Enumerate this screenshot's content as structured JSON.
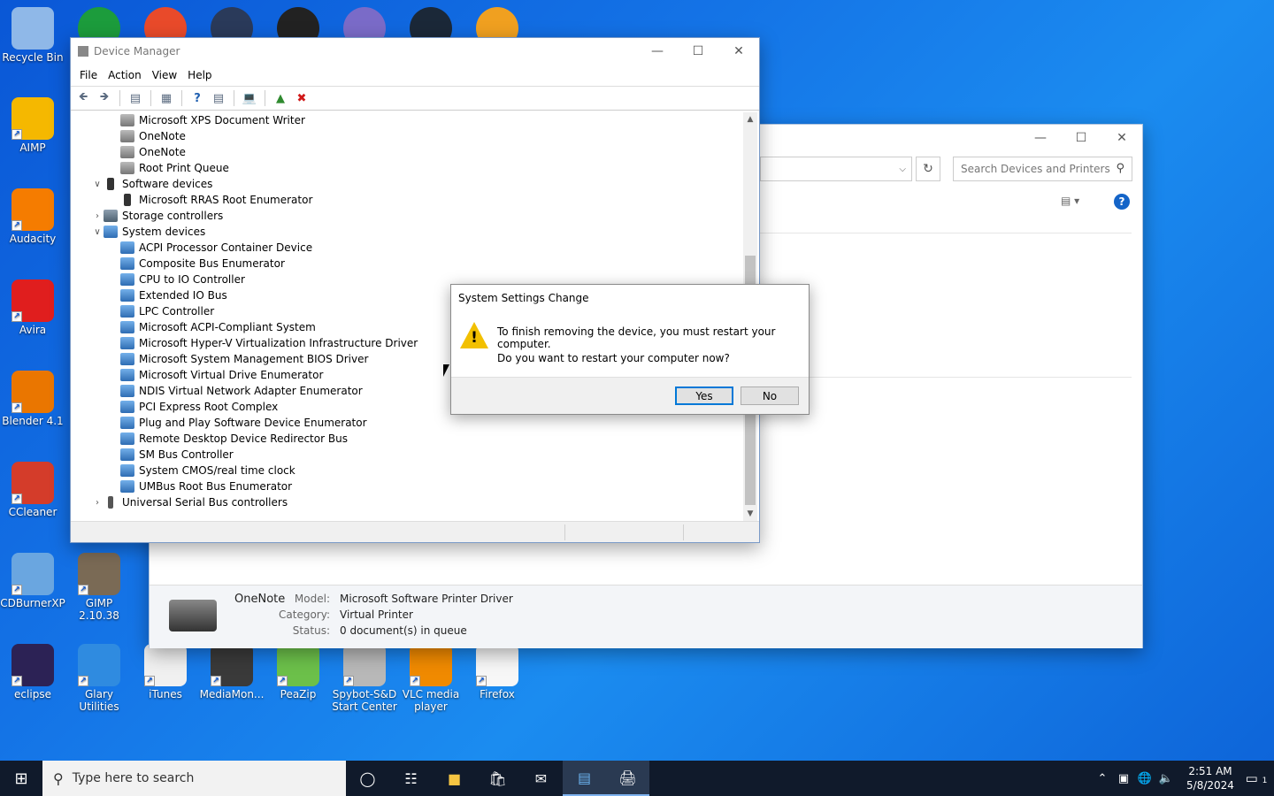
{
  "desktop": {
    "icons": [
      {
        "label": "Recycle Bin",
        "icon": "recycle-bin-icon",
        "color": "#8fb8e8"
      },
      {
        "label": "AIMP",
        "icon": "aimp-icon",
        "color": "#f5b800"
      },
      {
        "label": "Audacity",
        "icon": "audacity-icon",
        "color": "#f57c00"
      },
      {
        "label": "Avira",
        "icon": "avira-icon",
        "color": "#e01e1e"
      },
      {
        "label": "Blender 4.1",
        "icon": "blender-icon",
        "color": "#ea7600"
      },
      {
        "label": "CCleaner",
        "icon": "ccleaner-icon",
        "color": "#d43c2a"
      },
      {
        "label": "CDBurnerXP",
        "icon": "cdburnerxp-icon",
        "color": "#6aa6e0"
      },
      {
        "label": "GIMP 2.10.38",
        "icon": "gimp-icon",
        "color": "#7a6a55"
      },
      {
        "label": "eclipse",
        "icon": "eclipse-icon",
        "color": "#2c2255"
      },
      {
        "label": "Glary Utilities",
        "icon": "glary-utilities-icon",
        "color": "#2f8be0"
      },
      {
        "label": "iTunes",
        "icon": "itunes-icon",
        "color": "#f0f0f0"
      },
      {
        "label": "MediaMon...",
        "icon": "mediamonkey-icon",
        "color": "#3a3a3a"
      },
      {
        "label": "PeaZip",
        "icon": "peazip-icon",
        "color": "#6cc04a"
      },
      {
        "label": "Spybot-S&D Start Center",
        "icon": "spybot-icon",
        "color": "#b8b8b8"
      },
      {
        "label": "VLC media player",
        "icon": "vlc-icon",
        "color": "#f08a00"
      },
      {
        "label": "Firefox",
        "icon": "firefox-icon",
        "color": "#f7f7f7"
      }
    ]
  },
  "device_manager": {
    "title": "Device Manager",
    "menu": [
      "File",
      "Action",
      "View",
      "Help"
    ],
    "tree": [
      {
        "label": "Microsoft XPS Document Writer",
        "level": 2,
        "icon": "printer-icon"
      },
      {
        "label": "OneNote",
        "level": 2,
        "icon": "printer-icon"
      },
      {
        "label": "OneNote",
        "level": 2,
        "icon": "printer-icon"
      },
      {
        "label": "Root Print Queue",
        "level": 2,
        "icon": "printer-icon"
      },
      {
        "label": "Software devices",
        "level": 1,
        "icon": "software-device-icon",
        "expander": "expanded"
      },
      {
        "label": "Microsoft RRAS Root Enumerator",
        "level": 2,
        "icon": "software-device-icon"
      },
      {
        "label": "Storage controllers",
        "level": 1,
        "icon": "storage-controller-icon",
        "expander": "collapsed"
      },
      {
        "label": "System devices",
        "level": 1,
        "icon": "system-device-icon",
        "expander": "expanded"
      },
      {
        "label": "ACPI Processor Container Device",
        "level": 2,
        "icon": "system-device-icon"
      },
      {
        "label": "Composite Bus Enumerator",
        "level": 2,
        "icon": "system-device-icon"
      },
      {
        "label": "CPU to IO Controller",
        "level": 2,
        "icon": "system-device-icon"
      },
      {
        "label": "Extended IO Bus",
        "level": 2,
        "icon": "system-device-icon"
      },
      {
        "label": "LPC Controller",
        "level": 2,
        "icon": "system-device-icon"
      },
      {
        "label": "Microsoft ACPI-Compliant System",
        "level": 2,
        "icon": "system-device-icon"
      },
      {
        "label": "Microsoft Hyper-V Virtualization Infrastructure Driver",
        "level": 2,
        "icon": "system-device-icon"
      },
      {
        "label": "Microsoft System Management BIOS Driver",
        "level": 2,
        "icon": "system-device-icon"
      },
      {
        "label": "Microsoft Virtual Drive Enumerator",
        "level": 2,
        "icon": "system-device-icon"
      },
      {
        "label": "NDIS Virtual Network Adapter Enumerator",
        "level": 2,
        "icon": "system-device-icon"
      },
      {
        "label": "PCI Express Root Complex",
        "level": 2,
        "icon": "system-device-icon"
      },
      {
        "label": "Plug and Play Software Device Enumerator",
        "level": 2,
        "icon": "system-device-icon"
      },
      {
        "label": "Remote Desktop Device Redirector Bus",
        "level": 2,
        "icon": "system-device-icon"
      },
      {
        "label": "SM Bus Controller",
        "level": 2,
        "icon": "system-device-icon"
      },
      {
        "label": "System CMOS/real time clock",
        "level": 2,
        "icon": "system-device-icon"
      },
      {
        "label": "UMBus Root Bus Enumerator",
        "level": 2,
        "icon": "system-device-icon"
      },
      {
        "label": "Universal Serial Bus controllers",
        "level": 1,
        "icon": "usb-icon",
        "expander": "collapsed"
      }
    ]
  },
  "devices_printers": {
    "search_placeholder": "Search Devices and Printers",
    "details": {
      "name": "OneNote",
      "model_label": "Model:",
      "model": "Microsoft Software Printer Driver",
      "category_label": "Category:",
      "category": "Virtual Printer",
      "status_label": "Status:",
      "status": "0 document(s) in queue"
    }
  },
  "dialog": {
    "title": "System Settings Change",
    "message1": "To finish removing the device, you must restart your computer.",
    "message2": "Do you want to restart your computer now?",
    "yes_label": "Yes",
    "no_label": "No"
  },
  "taskbar": {
    "search_placeholder": "Type here to search",
    "time": "2:51 AM",
    "date": "5/8/2024",
    "notification_count": "1"
  }
}
